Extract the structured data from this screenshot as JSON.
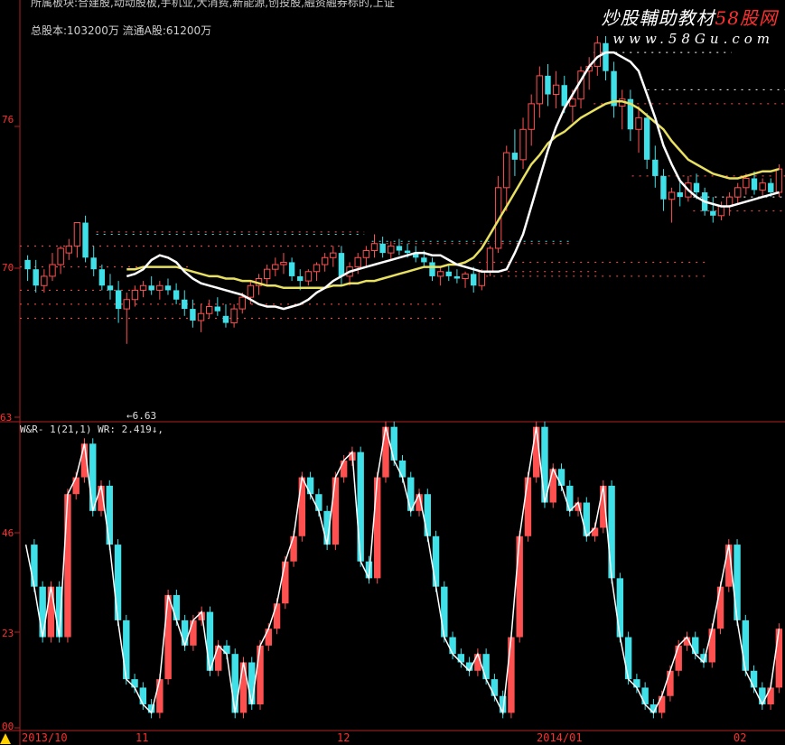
{
  "header": {
    "top_text": "所属板块:合建股,动动股板,手机业,大消费,新能源,创投股,融资融券标的,上证",
    "shares_text": "总股本:103200万 流通A股:61200万",
    "indicator_text": "W&R- 1(21,1) WR: 2.419↓,"
  },
  "watermark": {
    "brand_prefix": "炒股輔助教材",
    "brand_suffix": "58股网",
    "url": "www.58Gu.com"
  },
  "colors": {
    "background": "#000000",
    "up_candle": "#ff5050",
    "down_candle": "#40e0e8",
    "ma_fast": "#ffffff",
    "ma_slow": "#e8e060",
    "axis": "#b02020",
    "grid_label": "#ff3030",
    "dotted_level": "#ff5050",
    "cyan_level": "#40e0e8",
    "marker": "#ffd000"
  },
  "chart_data": [
    {
      "type": "candlestick",
      "y_tick_labels": [
        "76",
        "70",
        "63"
      ],
      "low_marker_label": "←6.63",
      "x_tick_labels": [
        "2013/10",
        "11",
        "12",
        "2014/01",
        "02"
      ],
      "ylim": [
        6.3,
        7.95
      ],
      "ohlc": [
        [
          6.99,
          7.01,
          6.9,
          6.95
        ],
        [
          6.95,
          6.99,
          6.85,
          6.88
        ],
        [
          6.88,
          6.95,
          6.85,
          6.92
        ],
        [
          6.92,
          7.02,
          6.9,
          6.97
        ],
        [
          6.97,
          7.05,
          6.93,
          7.04
        ],
        [
          7.02,
          7.08,
          6.99,
          7.05
        ],
        [
          7.05,
          7.15,
          7.0,
          7.15
        ],
        [
          7.15,
          7.18,
          6.98,
          7.0
        ],
        [
          7.0,
          7.05,
          6.92,
          6.95
        ],
        [
          6.95,
          6.97,
          6.86,
          6.88
        ],
        [
          6.88,
          6.93,
          6.82,
          6.86
        ],
        [
          6.86,
          6.9,
          6.72,
          6.78
        ],
        [
          6.78,
          6.85,
          6.63,
          6.82
        ],
        [
          6.82,
          6.88,
          6.79,
          6.86
        ],
        [
          6.86,
          6.9,
          6.83,
          6.88
        ],
        [
          6.88,
          6.92,
          6.84,
          6.86
        ],
        [
          6.86,
          6.9,
          6.82,
          6.88
        ],
        [
          6.88,
          6.91,
          6.84,
          6.86
        ],
        [
          6.86,
          6.89,
          6.8,
          6.82
        ],
        [
          6.82,
          6.86,
          6.75,
          6.78
        ],
        [
          6.78,
          6.82,
          6.7,
          6.73
        ],
        [
          6.73,
          6.8,
          6.68,
          6.76
        ],
        [
          6.76,
          6.82,
          6.74,
          6.79
        ],
        [
          6.79,
          6.83,
          6.75,
          6.77
        ],
        [
          6.75,
          6.8,
          6.7,
          6.72
        ],
        [
          6.72,
          6.8,
          6.7,
          6.78
        ],
        [
          6.78,
          6.85,
          6.76,
          6.83
        ],
        [
          6.83,
          6.9,
          6.8,
          6.88
        ],
        [
          6.88,
          6.93,
          6.84,
          6.91
        ],
        [
          6.91,
          6.97,
          6.88,
          6.95
        ],
        [
          6.95,
          7.0,
          6.92,
          6.97
        ],
        [
          6.97,
          7.02,
          6.93,
          6.98
        ],
        [
          6.98,
          7.0,
          6.9,
          6.92
        ],
        [
          6.92,
          6.95,
          6.86,
          6.9
        ],
        [
          6.9,
          6.95,
          6.88,
          6.94
        ],
        [
          6.94,
          6.98,
          6.9,
          6.97
        ],
        [
          6.97,
          7.02,
          6.94,
          7.0
        ],
        [
          7.0,
          7.05,
          6.96,
          7.02
        ],
        [
          7.02,
          7.05,
          6.88,
          6.92
        ],
        [
          6.92,
          6.98,
          6.88,
          6.96
        ],
        [
          6.96,
          7.02,
          6.93,
          7.0
        ],
        [
          7.0,
          7.05,
          6.96,
          7.03
        ],
        [
          7.03,
          7.1,
          7.0,
          7.06
        ],
        [
          7.06,
          7.09,
          7.0,
          7.02
        ],
        [
          7.02,
          7.07,
          6.99,
          7.05
        ],
        [
          7.05,
          7.08,
          7.01,
          7.03
        ],
        [
          7.03,
          7.06,
          7.0,
          7.02
        ],
        [
          7.02,
          7.05,
          6.98,
          7.0
        ],
        [
          7.0,
          7.03,
          6.96,
          6.98
        ],
        [
          6.98,
          7.0,
          6.9,
          6.92
        ],
        [
          6.92,
          6.96,
          6.88,
          6.94
        ],
        [
          6.94,
          6.97,
          6.9,
          6.92
        ],
        [
          6.92,
          6.95,
          6.89,
          6.91
        ],
        [
          6.91,
          6.94,
          6.87,
          6.93
        ],
        [
          6.93,
          6.96,
          6.85,
          6.88
        ],
        [
          6.88,
          6.95,
          6.86,
          6.94
        ],
        [
          6.94,
          7.05,
          6.92,
          7.04
        ],
        [
          7.04,
          7.35,
          7.02,
          7.3
        ],
        [
          7.3,
          7.48,
          7.2,
          7.45
        ],
        [
          7.45,
          7.55,
          7.35,
          7.42
        ],
        [
          7.42,
          7.6,
          7.38,
          7.55
        ],
        [
          7.55,
          7.7,
          7.48,
          7.66
        ],
        [
          7.66,
          7.82,
          7.6,
          7.78
        ],
        [
          7.78,
          7.83,
          7.65,
          7.7
        ],
        [
          7.7,
          7.8,
          7.64,
          7.74
        ],
        [
          7.74,
          7.78,
          7.62,
          7.65
        ],
        [
          7.65,
          7.72,
          7.58,
          7.68
        ],
        [
          7.68,
          7.82,
          7.64,
          7.8
        ],
        [
          7.8,
          7.86,
          7.72,
          7.82
        ],
        [
          7.82,
          7.95,
          7.78,
          7.92
        ],
        [
          7.92,
          7.95,
          7.76,
          7.8
        ],
        [
          7.8,
          7.84,
          7.6,
          7.65
        ],
        [
          7.65,
          7.72,
          7.55,
          7.68
        ],
        [
          7.68,
          7.72,
          7.5,
          7.55
        ],
        [
          7.55,
          7.65,
          7.45,
          7.6
        ],
        [
          7.6,
          7.62,
          7.38,
          7.42
        ],
        [
          7.42,
          7.48,
          7.3,
          7.35
        ],
        [
          7.35,
          7.38,
          7.2,
          7.25
        ],
        [
          7.25,
          7.3,
          7.15,
          7.28
        ],
        [
          7.28,
          7.34,
          7.22,
          7.26
        ],
        [
          7.26,
          7.35,
          7.24,
          7.32
        ],
        [
          7.32,
          7.36,
          7.25,
          7.28
        ],
        [
          7.28,
          7.3,
          7.18,
          7.2
        ],
        [
          7.2,
          7.26,
          7.15,
          7.18
        ],
        [
          7.18,
          7.24,
          7.16,
          7.22
        ],
        [
          7.22,
          7.28,
          7.18,
          7.26
        ],
        [
          7.26,
          7.32,
          7.23,
          7.3
        ],
        [
          7.3,
          7.36,
          7.27,
          7.34
        ],
        [
          7.34,
          7.37,
          7.27,
          7.29
        ],
        [
          7.29,
          7.34,
          7.26,
          7.32
        ],
        [
          7.32,
          7.34,
          7.26,
          7.28
        ],
        [
          7.28,
          7.4,
          7.26,
          7.38
        ]
      ],
      "ma_fast": [
        6.92,
        6.93,
        6.95,
        6.99,
        7.01,
        7.0,
        6.98,
        6.94,
        6.91,
        6.89,
        6.88,
        6.87,
        6.86,
        6.85,
        6.84,
        6.82,
        6.8,
        6.79,
        6.79,
        6.78,
        6.79,
        6.8,
        6.82,
        6.85,
        6.87,
        6.9,
        6.92,
        6.94,
        6.95,
        6.96,
        6.97,
        6.98,
        6.99,
        7.0,
        7.01,
        7.02,
        7.02,
        7.01,
        7.01,
        6.99,
        6.97,
        6.96,
        6.95,
        6.94,
        6.94,
        6.94,
        6.95,
        7.02,
        7.1,
        7.22,
        7.34,
        7.46,
        7.56,
        7.64,
        7.7,
        7.76,
        7.82,
        7.86,
        7.88,
        7.88,
        7.86,
        7.84,
        7.8,
        7.7,
        7.6,
        7.48,
        7.4,
        7.33,
        7.29,
        7.26,
        7.24,
        7.23,
        7.22,
        7.22,
        7.23,
        7.24,
        7.25,
        7.26,
        7.27,
        7.28
      ],
      "ma_slow": [
        6.95,
        6.95,
        6.96,
        6.96,
        6.96,
        6.96,
        6.96,
        6.95,
        6.94,
        6.93,
        6.92,
        6.92,
        6.91,
        6.91,
        6.9,
        6.9,
        6.89,
        6.88,
        6.88,
        6.87,
        6.87,
        6.87,
        6.87,
        6.87,
        6.87,
        6.88,
        6.88,
        6.89,
        6.89,
        6.9,
        6.9,
        6.91,
        6.92,
        6.93,
        6.94,
        6.95,
        6.96,
        6.96,
        6.96,
        6.97,
        6.97,
        6.98,
        7.0,
        7.04,
        7.1,
        7.16,
        7.22,
        7.28,
        7.34,
        7.4,
        7.44,
        7.49,
        7.52,
        7.54,
        7.57,
        7.6,
        7.62,
        7.64,
        7.66,
        7.67,
        7.67,
        7.66,
        7.64,
        7.61,
        7.58,
        7.55,
        7.5,
        7.46,
        7.42,
        7.4,
        7.38,
        7.36,
        7.35,
        7.34,
        7.34,
        7.35,
        7.36,
        7.37,
        7.37,
        7.38
      ]
    },
    {
      "type": "bar",
      "title": "W&R- 1(21,1) WR: 2.419↓,",
      "y_tick_labels": [
        "46",
        "23",
        "00"
      ],
      "ylim": [
        0,
        70
      ],
      "values": [
        44,
        34,
        22,
        34,
        22,
        56,
        60,
        68,
        52,
        58,
        44,
        26,
        12,
        10,
        6,
        4,
        12,
        32,
        26,
        20,
        26,
        28,
        14,
        20,
        18,
        4,
        16,
        6,
        20,
        24,
        30,
        40,
        46,
        60,
        56,
        52,
        44,
        60,
        64,
        66,
        40,
        36,
        60,
        72,
        64,
        60,
        52,
        56,
        46,
        34,
        22,
        18,
        16,
        14,
        18,
        12,
        8,
        4,
        22,
        46,
        60,
        72,
        54,
        62,
        58,
        52,
        54,
        46,
        48,
        58,
        36,
        22,
        12,
        10,
        6,
        4,
        8,
        14,
        20,
        22,
        18,
        16,
        24,
        34,
        44,
        26,
        14,
        10,
        6,
        10,
        24
      ]
    }
  ]
}
